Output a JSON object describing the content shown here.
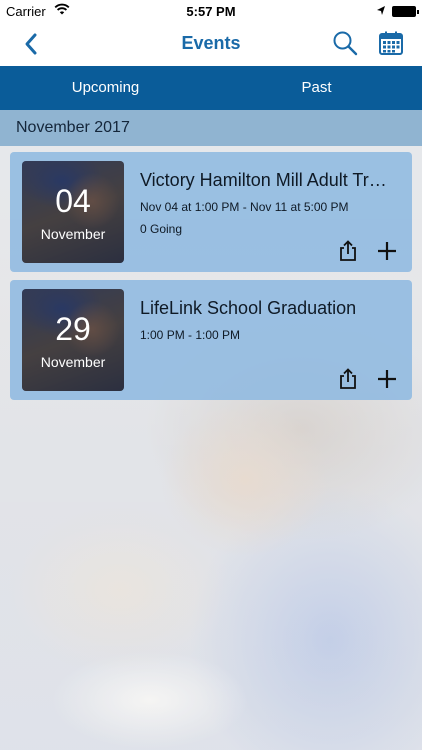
{
  "status_bar": {
    "carrier": "Carrier",
    "time": "5:57 PM"
  },
  "nav": {
    "title": "Events",
    "accent_color": "#1a6aa8"
  },
  "tabs": [
    {
      "label": "Upcoming"
    },
    {
      "label": "Past"
    }
  ],
  "section": {
    "header": "November 2017"
  },
  "events": [
    {
      "day": "04",
      "month": "November",
      "title": "Victory Hamilton Mill Adult Tr…",
      "time": "Nov 04 at 1:00 PM - Nov 11 at 5:00 PM",
      "going": "0 Going"
    },
    {
      "day": "29",
      "month": "November",
      "title": "LifeLink School Graduation",
      "time": "1:00 PM - 1:00 PM"
    }
  ],
  "icons": {
    "back": "chevron-left-icon",
    "search": "search-icon",
    "calendar": "calendar-icon",
    "share": "share-icon",
    "add": "plus-icon"
  }
}
